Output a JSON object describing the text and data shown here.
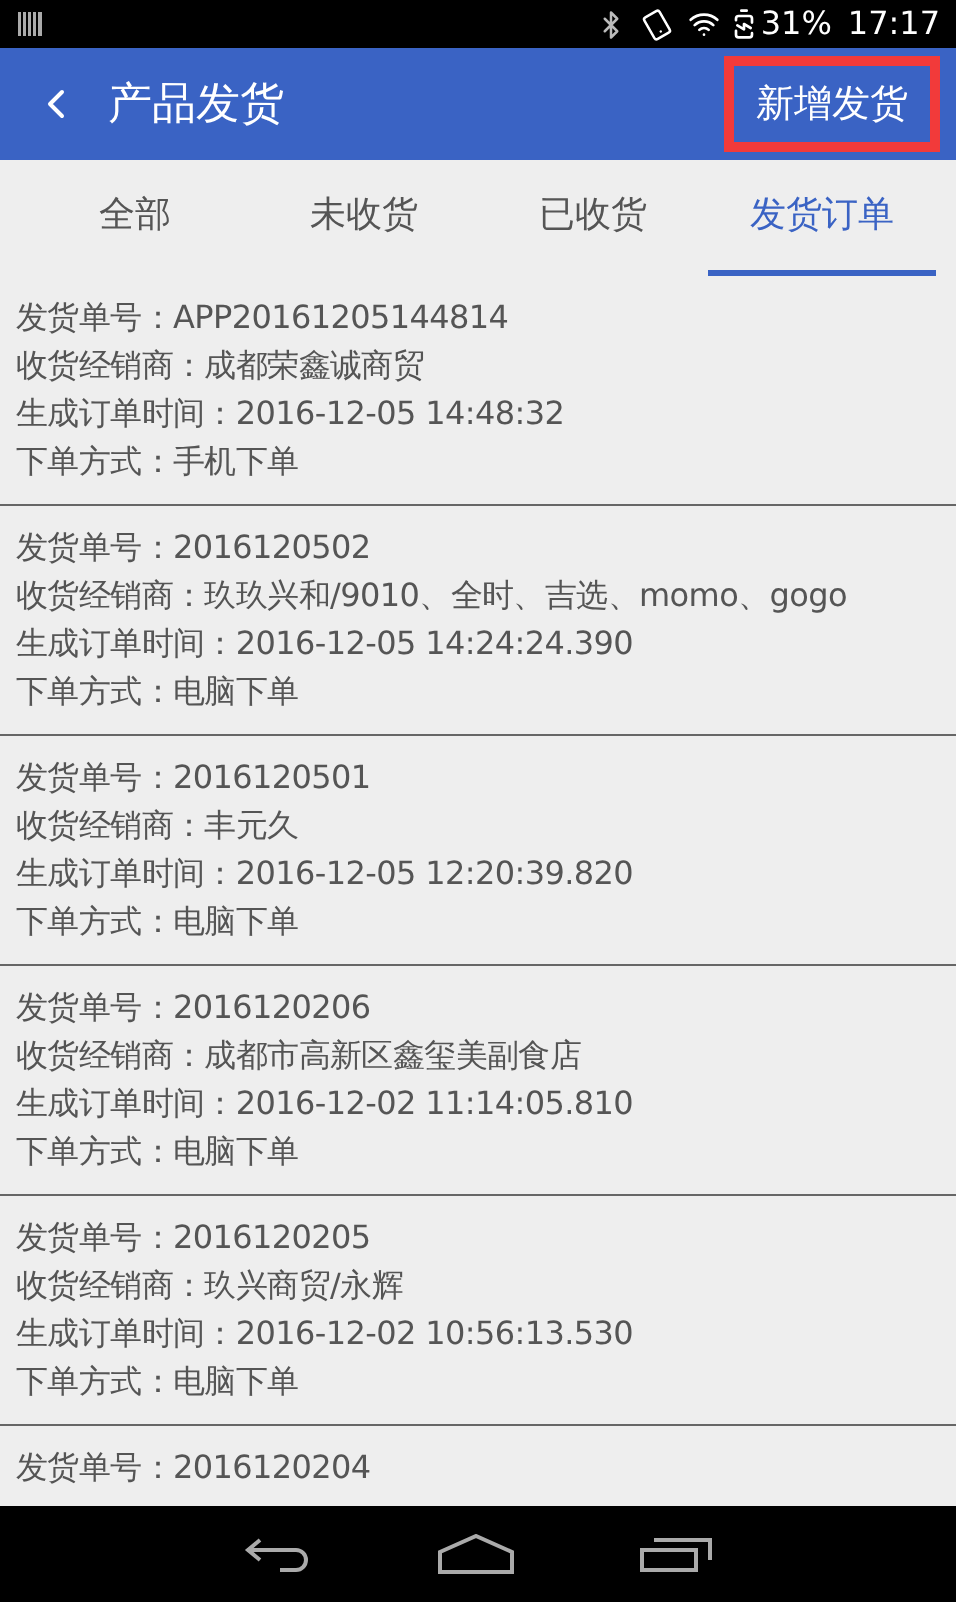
{
  "status_bar": {
    "battery": "31%",
    "time": "17:17"
  },
  "header": {
    "title": "产品发货",
    "action": {
      "label": "新增发货",
      "highlighted": true
    }
  },
  "tabs": [
    {
      "label": "全部",
      "selected": false
    },
    {
      "label": "未收货",
      "selected": false
    },
    {
      "label": "已收货",
      "selected": false
    },
    {
      "label": "发货订单",
      "selected": true
    }
  ],
  "orders": [
    {
      "lines": [
        "发货单号：APP20161205144814",
        "收货经销商：成都荣鑫诚商贸",
        "生成订单时间：2016-12-05 14:48:32",
        "下单方式：手机下单"
      ]
    },
    {
      "lines": [
        "发货单号：2016120502",
        "收货经销商：玖玖兴和/9010、全时、吉选、momo、gogo",
        "生成订单时间：2016-12-05 14:24:24.390",
        "下单方式：电脑下单"
      ]
    },
    {
      "lines": [
        "发货单号：2016120501",
        "收货经销商：丰元久",
        "生成订单时间：2016-12-05 12:20:39.820",
        "下单方式：电脑下单"
      ]
    },
    {
      "lines": [
        "发货单号：2016120206",
        "收货经销商：成都市高新区鑫玺美副食店",
        "生成订单时间：2016-12-02 11:14:05.810",
        "下单方式：电脑下单"
      ]
    },
    {
      "lines": [
        "发货单号：2016120205",
        "收货经销商：玖兴商贸/永辉",
        "生成订单时间：2016-12-02 10:56:13.530",
        "下单方式：电脑下单"
      ]
    },
    {
      "lines": [
        "发货单号：2016120204"
      ]
    }
  ]
}
